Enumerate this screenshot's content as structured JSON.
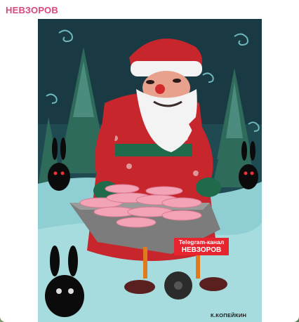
{
  "post": {
    "channel_name": "НЕВЗОРОВ"
  },
  "image": {
    "subject": "Painting of Santa Claus pushing a wheelbarrow",
    "watermark": {
      "line1": "Telegram-канал",
      "line2": "НЕВЗОРОВ"
    },
    "signature": "К.КОПЕЙКИН"
  },
  "colors": {
    "channel_name": "#d6477f",
    "watermark_bg": "#e8252e",
    "sky": "#1a3a43",
    "snow": "#8fcfd3",
    "santa_coat": "#c7262c",
    "trim": "#1f6a4a"
  }
}
